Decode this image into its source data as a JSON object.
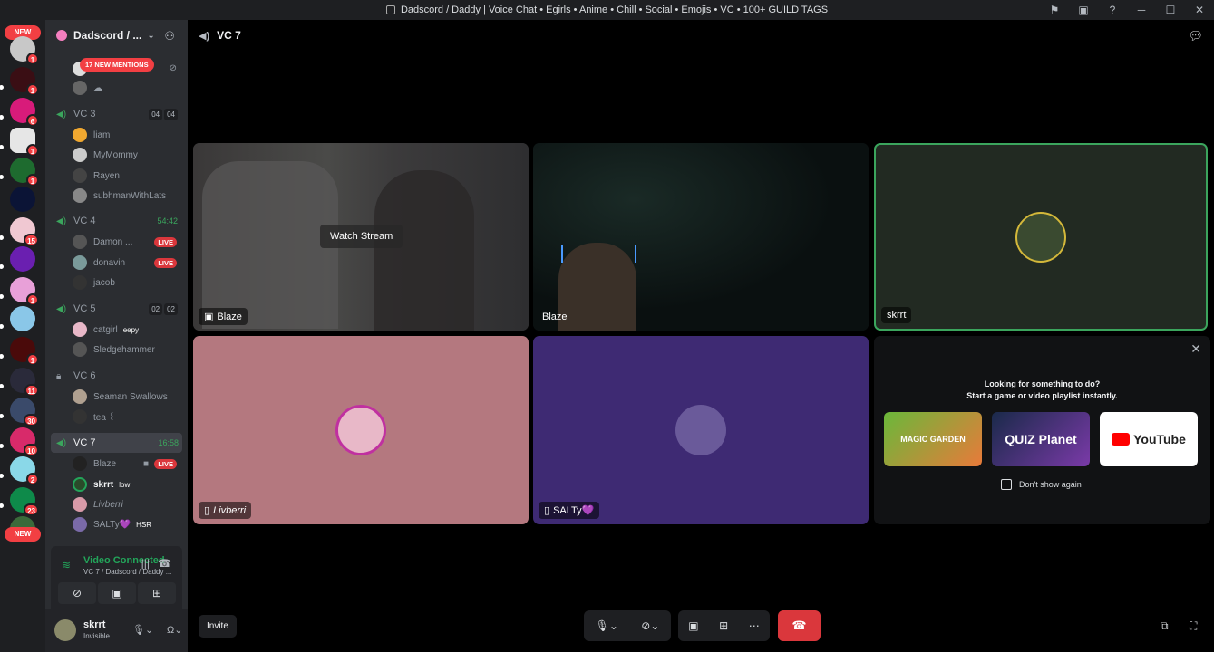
{
  "window": {
    "title": "Dadscord / Daddy | Voice Chat • Egirls • Anime • Chill • Social • Emojis • VC • 100+ GUILD TAGS"
  },
  "guilds": {
    "new_top": "NEW",
    "new_bottom": "NEW",
    "badges": [
      "1",
      "1",
      "6",
      "1",
      "1",
      "",
      "15",
      "",
      "1",
      "",
      "1",
      "11",
      "30",
      "10",
      "2",
      "23"
    ]
  },
  "server": {
    "name": "Dadscord / ...",
    "mentions_pill": "17 NEW MENTIONS"
  },
  "channels": [
    {
      "name": "VC 3",
      "counts": [
        "04",
        "04"
      ],
      "users": [
        "liam",
        "MyMommy",
        "Rayen",
        "subhmanWithLats"
      ]
    },
    {
      "name": "VC 4",
      "timer": "54:42",
      "users": [
        {
          "name": "Damon ...",
          "live": "LIVE"
        },
        {
          "name": "donavin",
          "live": "LIVE"
        },
        {
          "name": "jacob"
        }
      ]
    },
    {
      "name": "VC 5",
      "counts": [
        "02",
        "02"
      ],
      "users": [
        {
          "name": "catgirl",
          "tag": "eepy"
        },
        {
          "name": "Sledgehammer"
        }
      ]
    },
    {
      "name": "VC 6",
      "users": [
        "Seaman Swallows",
        "tea ꒰"
      ]
    },
    {
      "name": "VC 7",
      "timer": "16:58",
      "users": [
        {
          "name": "Blaze",
          "live": "LIVE"
        },
        {
          "name": "skrrt",
          "tag": "low"
        },
        {
          "name": "Livberri"
        },
        {
          "name": "SALTy💜",
          "tag": "HSR"
        }
      ]
    }
  ],
  "voice_status": {
    "status": "Video Connected",
    "location": "VC 7 / Dadscord / Daddy ..."
  },
  "user": {
    "name": "skrrt",
    "status": "Invisible"
  },
  "main": {
    "channel": "VC 7",
    "watch_stream": "Watch Stream",
    "tiles": {
      "stream": "Blaze",
      "cam": "Blaze",
      "skrrt": "skrrt",
      "livberri": "Livberri",
      "salty": "SALTy💜"
    },
    "activity": {
      "line1": "Looking for something to do?",
      "line2": "Start a game or video playlist instantly.",
      "card1": "MAGIC GARDEN",
      "card2": "QUIZ Planet",
      "card3": "YouTube",
      "dont_show": "Don't show again"
    },
    "invite": "Invite"
  },
  "colors": {
    "accent_green": "#23a55a",
    "live_red": "#da373c",
    "pink_tile": "#b4787f",
    "purple_tile": "#3e2a73"
  }
}
